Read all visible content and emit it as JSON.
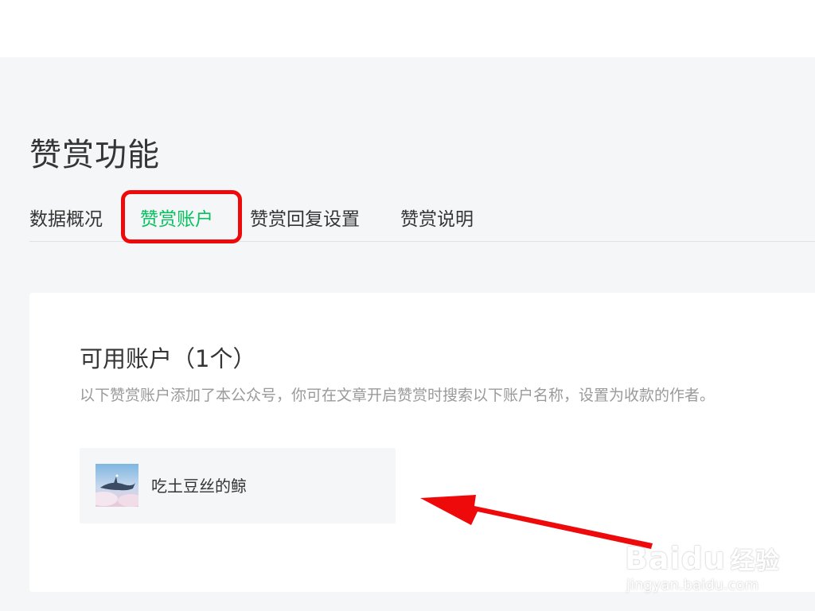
{
  "header": {
    "page_title": "赞赏功能"
  },
  "tabs": [
    {
      "label": "数据概况",
      "active": false
    },
    {
      "label": "赞赏账户",
      "active": true
    },
    {
      "label": "赞赏回复设置",
      "active": false
    },
    {
      "label": "赞赏说明",
      "active": false
    }
  ],
  "accounts_section": {
    "title": "可用账户（1个）",
    "description": "以下赞赏账户添加了本公众号，你可在文章开启赞赏时搜索以下账户名称，设置为收款的作者。",
    "items": [
      {
        "name": "吃土豆丝的鲸",
        "avatar_icon": "whale-avatar"
      }
    ]
  },
  "watermark": {
    "brand": "Bai",
    "brand_suffix": "du",
    "brand_cn": "经验",
    "url": "jingyan.baidu.com"
  },
  "colors": {
    "accent_green": "#07c160",
    "highlight_red": "#ee0a0a",
    "background": "#f5f6f7"
  }
}
